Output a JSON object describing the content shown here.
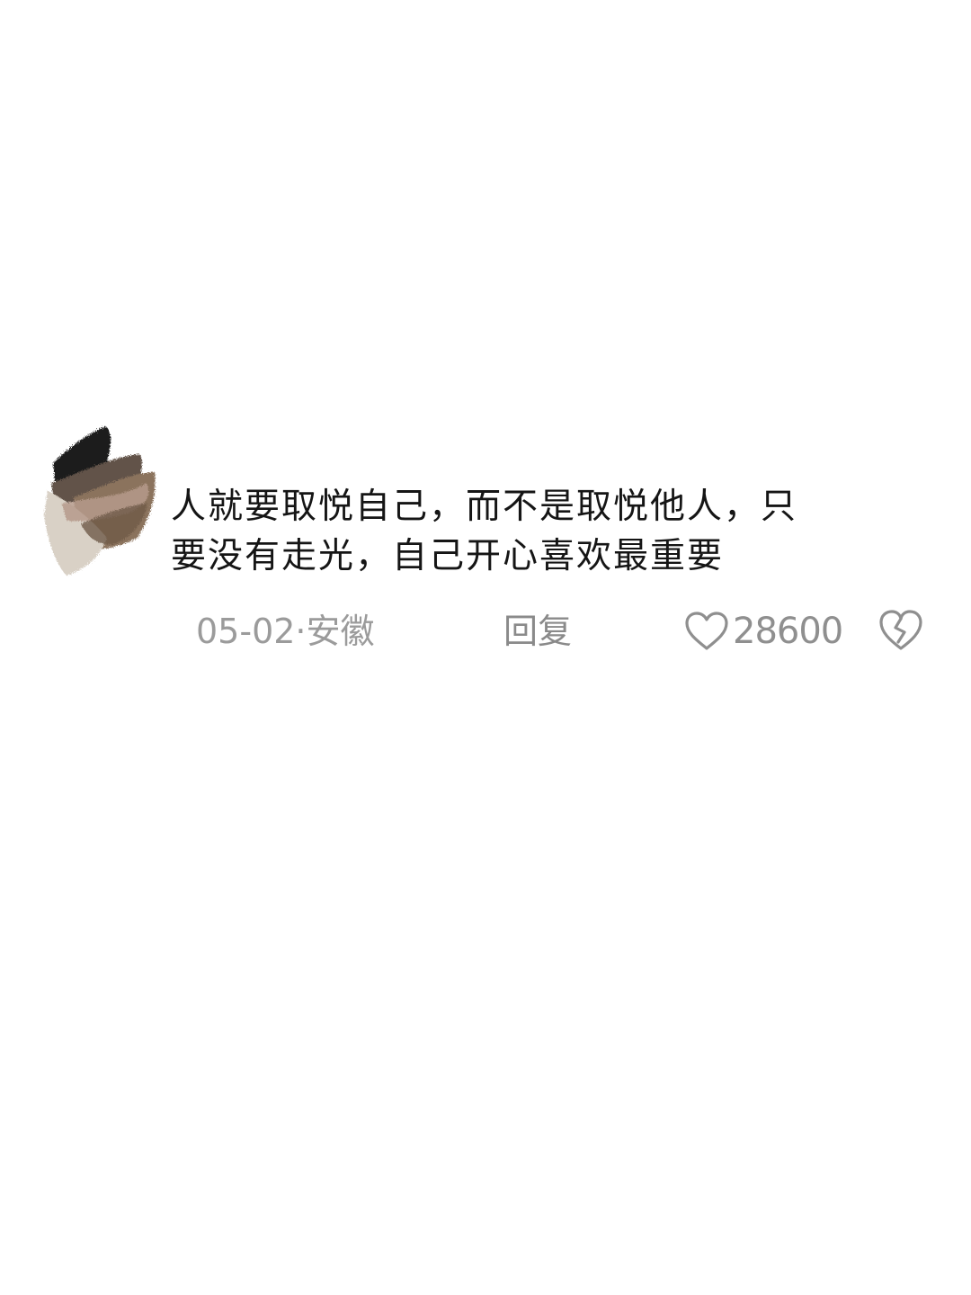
{
  "comment": {
    "text_line_1": "人就要取悦自己，而不是取悦他人，只",
    "text_line_2": "要没有走光，自己开心喜欢最重要",
    "date": "05-02",
    "location_separator": "·",
    "location": "安徽",
    "reply_label": "回复",
    "like_count": "28600",
    "avatar_icon": "brush-stroke-avatar",
    "like_icon": "heart-icon",
    "dislike_icon": "broken-heart-icon",
    "colors": {
      "text": "#151515",
      "meta": "#9b9b9b",
      "icon": "#8f8f8f"
    }
  }
}
